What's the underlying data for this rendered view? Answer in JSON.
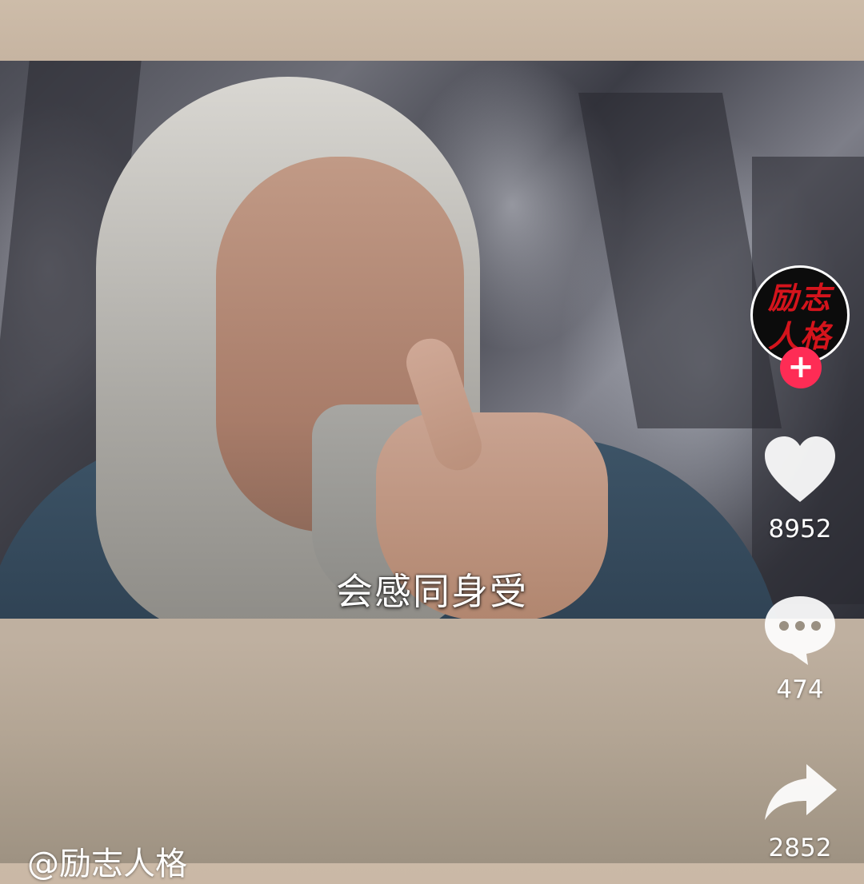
{
  "video": {
    "subtitle": "会感同身受"
  },
  "author": {
    "avatar_text_line1": "励志",
    "avatar_text_line2": "人格",
    "handle": "@励志人格",
    "follow_symbol": "+"
  },
  "actions": {
    "likes": "8952",
    "comments": "474",
    "shares": "2852"
  },
  "colors": {
    "follow_button": "#fe2c55",
    "avatar_text": "#d4141c",
    "icon_fill": "#ffffff"
  },
  "icons": [
    "heart-icon",
    "comment-icon",
    "share-icon",
    "plus-icon"
  ]
}
